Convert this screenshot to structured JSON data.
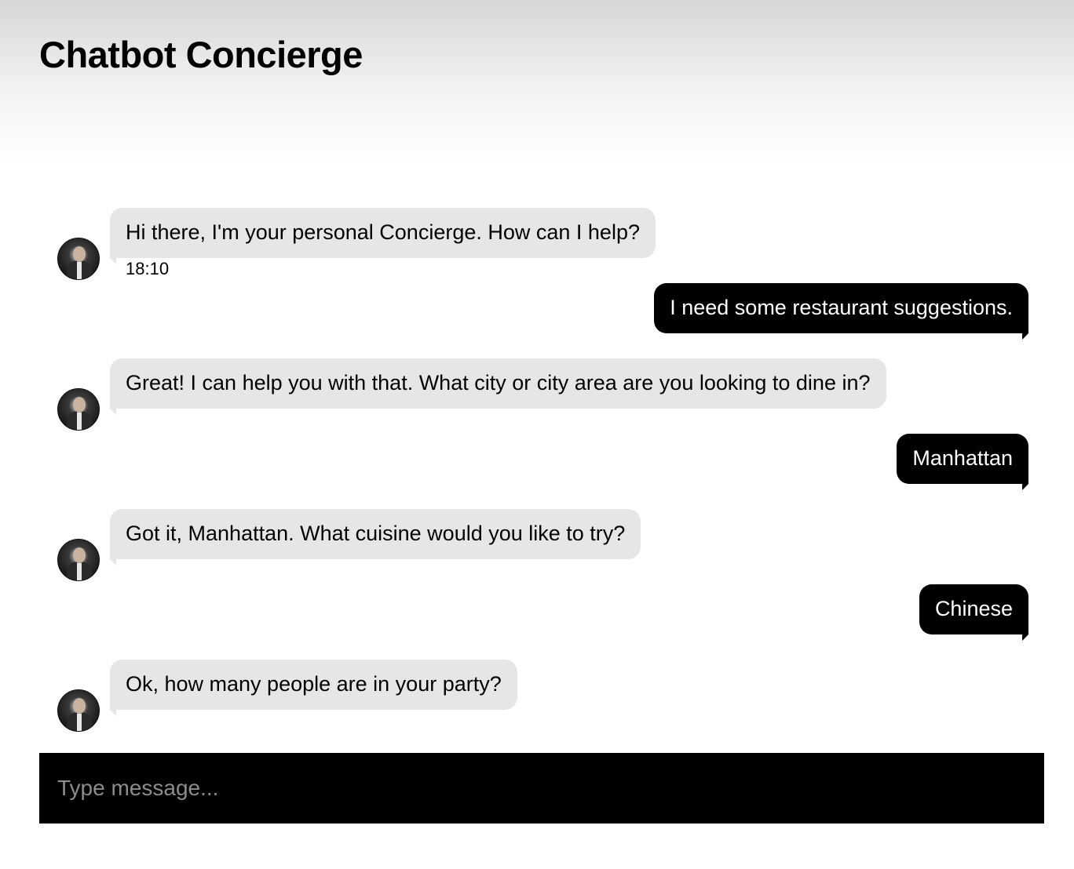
{
  "header": {
    "title": "Chatbot Concierge"
  },
  "messages": [
    {
      "sender": "bot",
      "text": "Hi there, I'm your personal Concierge. How can I help?",
      "time": "18:10"
    },
    {
      "sender": "user",
      "text": "I need some restaurant suggestions."
    },
    {
      "sender": "bot",
      "text": "Great! I can help you with that. What city or city area are you looking to dine in?"
    },
    {
      "sender": "user",
      "text": "Manhattan"
    },
    {
      "sender": "bot",
      "text": "Got it, Manhattan. What cuisine would you like to try?"
    },
    {
      "sender": "user",
      "text": "Chinese"
    },
    {
      "sender": "bot",
      "text": "Ok, how many people are in your party?"
    }
  ],
  "input": {
    "placeholder": "Type message...",
    "value": ""
  },
  "colors": {
    "bot_bubble": "#e6e6e6",
    "user_bubble": "#000000",
    "input_bar": "#000000"
  }
}
